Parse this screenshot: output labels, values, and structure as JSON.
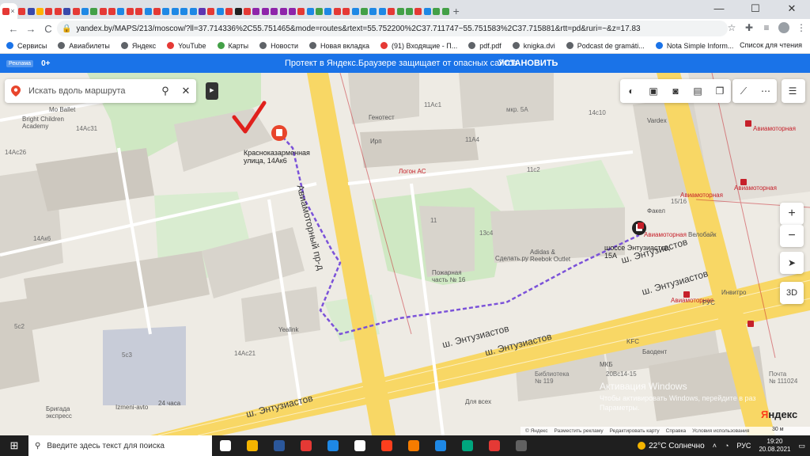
{
  "tabs": [
    {
      "color": "#e53935"
    },
    {
      "color": "#e53935"
    },
    {
      "color": "#3949ab"
    },
    {
      "color": "#ffb300"
    },
    {
      "color": "#e53935"
    },
    {
      "color": "#e53935"
    },
    {
      "color": "#3949ab"
    },
    {
      "color": "#e53935"
    },
    {
      "color": "#1e88e5"
    },
    {
      "color": "#43a047"
    },
    {
      "color": "#e53935"
    },
    {
      "color": "#e53935"
    },
    {
      "color": "#1e88e5"
    },
    {
      "color": "#e53935"
    },
    {
      "color": "#e53935"
    },
    {
      "color": "#1e88e5"
    },
    {
      "color": "#e53935"
    },
    {
      "color": "#1e88e5"
    },
    {
      "color": "#1e88e5"
    },
    {
      "color": "#1e88e5"
    },
    {
      "color": "#1e88e5"
    },
    {
      "color": "#5e35b1"
    },
    {
      "color": "#e53935"
    },
    {
      "color": "#1e88e5"
    },
    {
      "color": "#e53935"
    },
    {
      "color": "#212121"
    },
    {
      "color": "#e53935"
    },
    {
      "color": "#8e24aa"
    },
    {
      "color": "#8e24aa"
    },
    {
      "color": "#8e24aa"
    },
    {
      "color": "#8e24aa"
    },
    {
      "color": "#8e24aa"
    },
    {
      "color": "#e53935"
    },
    {
      "color": "#1e88e5"
    },
    {
      "color": "#43a047"
    },
    {
      "color": "#1e88e5"
    },
    {
      "color": "#e53935"
    },
    {
      "color": "#e53935"
    },
    {
      "color": "#1e88e5"
    },
    {
      "color": "#43a047"
    },
    {
      "color": "#1e88e5"
    },
    {
      "color": "#1e88e5"
    },
    {
      "color": "#e53935"
    },
    {
      "color": "#43a047"
    },
    {
      "color": "#43a047"
    },
    {
      "color": "#e53935"
    },
    {
      "color": "#1e88e5"
    },
    {
      "color": "#43a047"
    },
    {
      "color": "#43a047"
    }
  ],
  "browser": {
    "back_icon": "←",
    "forward_icon": "→",
    "reload_icon": "C",
    "home_icon": "⌂",
    "close_icon": "×",
    "new_tab_icon": "+",
    "minimize_icon": "—",
    "maximize_icon": "☐",
    "window_close_icon": "✕",
    "url": "yandex.by/MAPS/213/moscow/?ll=37.714336%2C55.751465&mode=routes&rtext=55.752200%2C37.711747~55.751583%2C37.715881&rtt=pd&ruri=~&z=17.83"
  },
  "bookmarks": {
    "items": [
      {
        "label": "Сервисы",
        "color": "#1a73e8"
      },
      {
        "label": "Авиабилеты",
        "color": "#5f6368"
      },
      {
        "label": "Яндекс",
        "color": "#5f6368"
      },
      {
        "label": "YouTube",
        "color": "#e53935"
      },
      {
        "label": "Карты",
        "color": "#43a047"
      },
      {
        "label": "Новости",
        "color": "#5f6368"
      },
      {
        "label": "Новая вкладка",
        "color": "#5f6368"
      },
      {
        "label": "(91) Входящие - П...",
        "color": "#e53935"
      },
      {
        "label": "pdf.pdf",
        "color": "#5f6368"
      },
      {
        "label": "knigka.dvi",
        "color": "#5f6368"
      },
      {
        "label": "Podcast de gramáti...",
        "color": "#5f6368"
      },
      {
        "label": "Nota Simple Inform...",
        "color": "#1a73e8"
      }
    ],
    "reading_list": "Список для чтения"
  },
  "banner": {
    "ad_label": "Реклама",
    "age": "0+",
    "text": "Протект в Яндекс.Браузере защищает от опасных сайтов",
    "button": "УСТАНОВИТЬ"
  },
  "map": {
    "search_placeholder": "Искать вдоль маршрута",
    "collapse_icon": "▶",
    "zoom_in": "+",
    "zoom_out": "−",
    "locate_icon": "➤",
    "view_3d": "3D",
    "labels": {
      "start_address": "Красноказарменная\nулица, 14Ак6",
      "end_address": "шоссе Энтузиастов,\n15А",
      "road_aviamotorny": "Авиамоторный пр-д",
      "road_entuziastov_1": "ш. Энтузиастов",
      "road_entuziastov_2": "ш. Энтузиастов",
      "road_entuziastov_3": "ш. Энтузиастов",
      "road_entuziastov_4": "ш. Энтузиастов",
      "road_entuziastov_5": "ш. Энтузиастов",
      "metro_aviamotornaya_1": "Авиамоторная",
      "metro_aviamotornaya_2": "Авиамоторная",
      "metro_aviamotornaya_3": "Авиамоторная",
      "metro_aviamotornaya_4": "Авиамоторная",
      "metro_aviamotornaya_5": "Авиамоторная",
      "mo_ballet": "Mo Ballet",
      "bright_children": "Bright Children\nAcademy",
      "b14ac31": "14Ac31",
      "b14ac26": "14Ac26",
      "b14ak6": "14Ак6",
      "b5c2": "5c2",
      "b5c3": "5c3",
      "b14ac21": "14Ac21",
      "genotest": "Генотест",
      "irp": "Ирп",
      "logon": "Логон АС",
      "b11a_c1": "11Ac1",
      "mkp": "мкр. 5А",
      "b14c10": "14c10",
      "b11a4": "11A4",
      "b11c2": "11c2",
      "b11": "11",
      "b13c4": "13c4",
      "b15_16": "15/16",
      "fakel": "Факел",
      "velobike": "Велобайк",
      "sdetal": "Сделать.ру",
      "adidas": "Adidas &\nReebok Outlet",
      "fire_station": "Пожарная\nчасть № 16",
      "yealink": "Yealink",
      "vardex": "Vardex",
      "rus": "РУС",
      "invitro": "Инвитро",
      "kfc": "KFC",
      "baodent": "Баодент",
      "mkb": "МКБ",
      "library": "Библиотека\n№ 119",
      "b20c14": "20Вс14-15",
      "post": "Почта\n№ 111024",
      "brigada": "Бригада\nэкспресс",
      "izmeni": "Izmeni-avto",
      "h24": "24 часа",
      "dlya_vsekh": "Для всех"
    },
    "watermark_title": "Активация Windows",
    "watermark_sub": "Чтобы активировать Windows, перейдите в раз\nПараметры.",
    "logo_ya": "Я",
    "logo_rest": "ндекс",
    "copyright": [
      "© Яндекс",
      "Разместить рекламу",
      "Редактировать карту",
      "Справка",
      "Условия использования"
    ],
    "scale": "30 м"
  },
  "taskbar": {
    "search_placeholder": "Введите здесь текст для поиска",
    "apps": [
      {
        "color": "#ffffff"
      },
      {
        "color": "#f4b400"
      },
      {
        "color": "#2b579a"
      },
      {
        "color": "#e53935"
      },
      {
        "color": "#1e88e5"
      },
      {
        "color": "#ffffff"
      },
      {
        "color": "#fc3f1d"
      },
      {
        "color": "#f57c00"
      },
      {
        "color": "#1e88e5"
      },
      {
        "color": "#00a67e"
      },
      {
        "color": "#e53935"
      },
      {
        "color": "#616161"
      }
    ],
    "weather": "22°C Солнечно",
    "lang": "РУС",
    "time": "19:20",
    "date": "20.08.2021"
  },
  "colors": {
    "route": "#7b52d9",
    "metro": "#c6202a",
    "pin_red": "#e8452c",
    "check_red": "#e0201c",
    "road_yellow": "#f8d765",
    "building": "#d8d4cc",
    "park": "#cfe8c3"
  }
}
